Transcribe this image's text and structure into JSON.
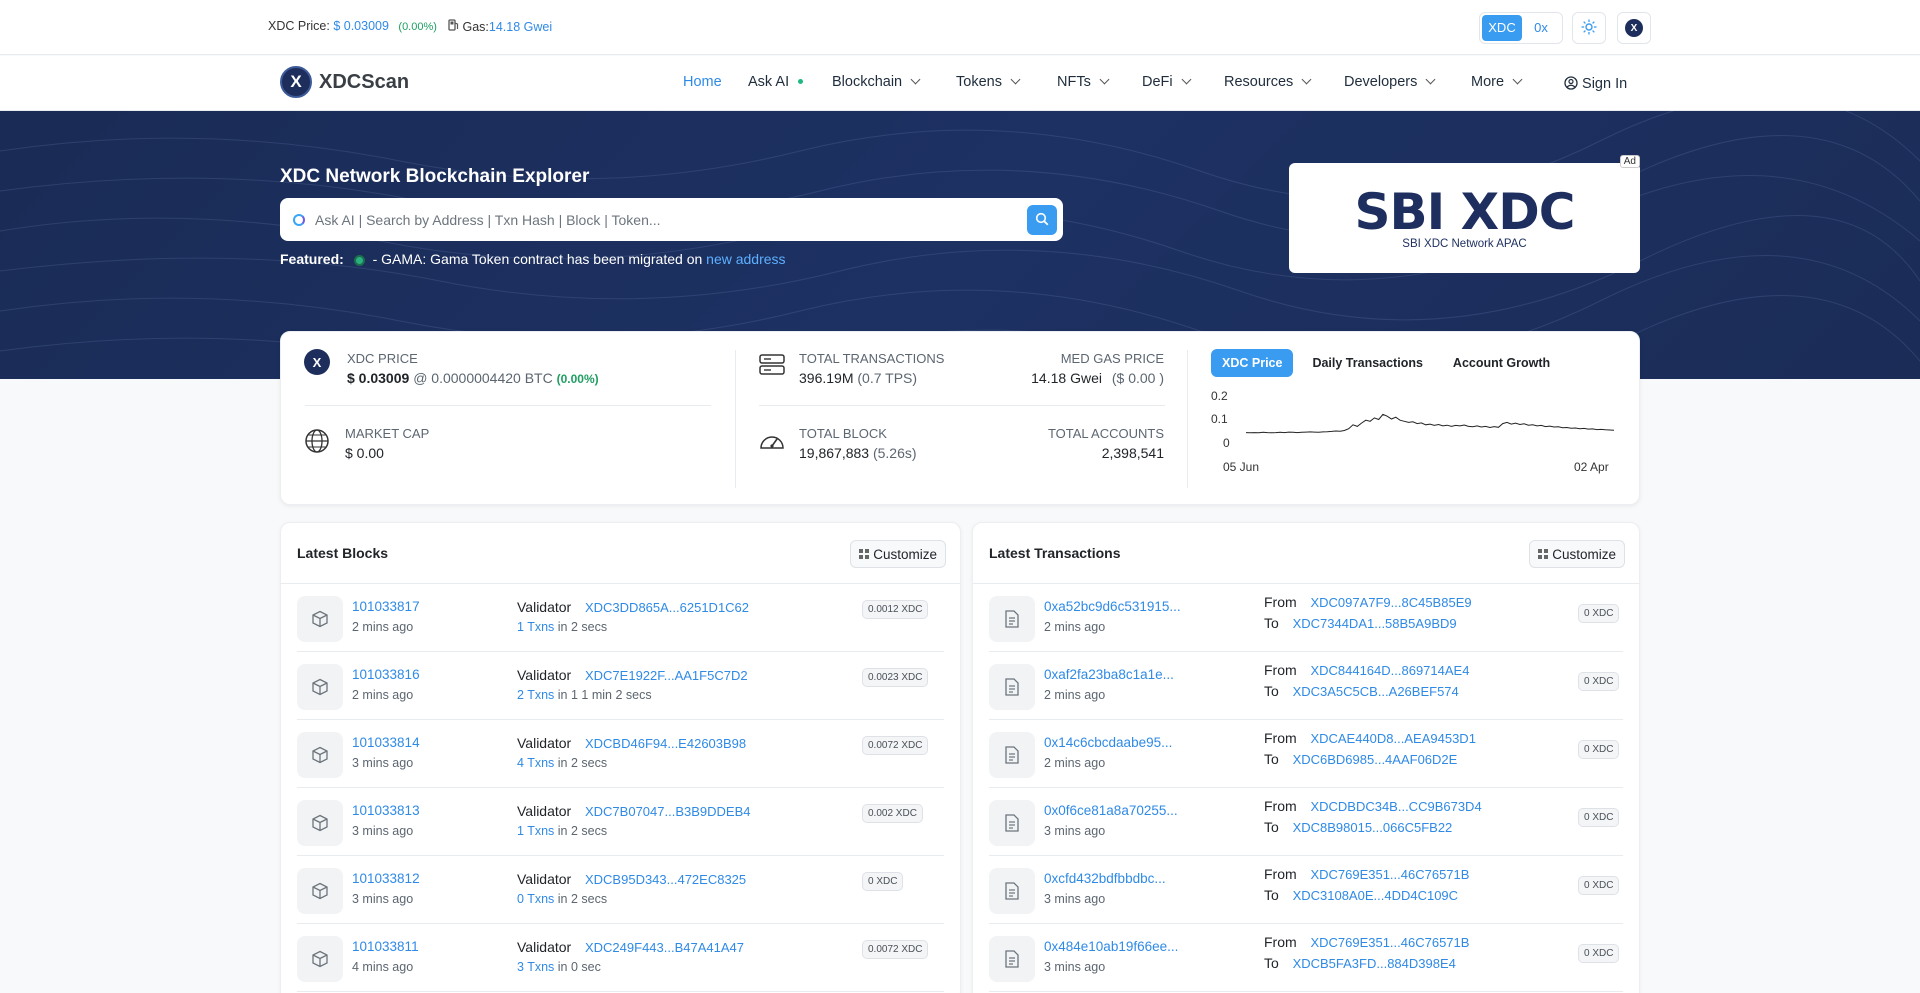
{
  "topbar": {
    "price_label": "XDC Price:",
    "price_value": "$ 0.03009",
    "price_change": "(0.00%)",
    "gas_label": "Gas:",
    "gas_value": "14.18 Gwei",
    "unit_toggle": [
      "XDC",
      "0x"
    ]
  },
  "nav": {
    "brand": "XDCScan",
    "logo_letter": "X",
    "items": [
      "Home",
      "Ask AI",
      "Blockchain",
      "Tokens",
      "NFTs",
      "DeFi",
      "Resources",
      "Developers",
      "More"
    ],
    "sign_in": "Sign In"
  },
  "hero": {
    "title": "XDC Network Blockchain Explorer",
    "search_placeholder": "Ask AI | Search by Address | Txn Hash | Block | Token...",
    "featured_label": "Featured:",
    "featured_text": "- GAMA: Gama Token contract has been migrated on",
    "featured_link": "new address",
    "ad_tag": "Ad",
    "ad_brand": "SBI XDC",
    "ad_sub": "SBI XDC Network APAC"
  },
  "stats": {
    "price_label": "XDC PRICE",
    "price_value": "$ 0.03009",
    "price_btc": "@ 0.0000004420 BTC",
    "price_change": "(0.00%)",
    "mcap_label": "MARKET CAP",
    "mcap_value": "$ 0.00",
    "tx_label": "TOTAL TRANSACTIONS",
    "tx_value": "396.19M",
    "tx_tps": "(0.7 TPS)",
    "gas_label": "MED GAS PRICE",
    "gas_value": "14.18 Gwei",
    "gas_usd": "($ 0.00 )",
    "block_label": "TOTAL BLOCK",
    "block_value": "19,867,883",
    "block_time": "(5.26s)",
    "acct_label": "TOTAL ACCOUNTS",
    "acct_value": "2,398,541",
    "tabs": [
      "XDC Price",
      "Daily Transactions",
      "Account Growth"
    ]
  },
  "chart_data": {
    "type": "line",
    "title": "",
    "xlabel": "",
    "ylabel": "",
    "x_ticks": [
      "05 Jun",
      "02 Apr"
    ],
    "y_ticks": [
      "0.2",
      "0.1",
      "0"
    ],
    "ylim": [
      0,
      0.2
    ],
    "series": [
      {
        "values": [
          0.041,
          0.04,
          0.041,
          0.04,
          0.042,
          0.041,
          0.04,
          0.041,
          0.042,
          0.041,
          0.043,
          0.042,
          0.041,
          0.042,
          0.043,
          0.044,
          0.043,
          0.042,
          0.044,
          0.045,
          0.046,
          0.048,
          0.047,
          0.05,
          0.058,
          0.075,
          0.068,
          0.082,
          0.095,
          0.09,
          0.105,
          0.098,
          0.12,
          0.112,
          0.1,
          0.108,
          0.095,
          0.09,
          0.085,
          0.088,
          0.08,
          0.083,
          0.075,
          0.078,
          0.072,
          0.076,
          0.07,
          0.073,
          0.068,
          0.072,
          0.07,
          0.074,
          0.068,
          0.066,
          0.07,
          0.065,
          0.068,
          0.063,
          0.067,
          0.064,
          0.08,
          0.085,
          0.078,
          0.082,
          0.076,
          0.079,
          0.073,
          0.075,
          0.07,
          0.072,
          0.067,
          0.069,
          0.065,
          0.066,
          0.062,
          0.063,
          0.06,
          0.061,
          0.058,
          0.059,
          0.056,
          0.057,
          0.054,
          0.055,
          0.053,
          0.052,
          0.051
        ]
      }
    ]
  },
  "blocks": {
    "title": "Latest Blocks",
    "customize": "Customize",
    "validator_label": "Validator",
    "rows": [
      {
        "number": "101033817",
        "age": "2 mins ago",
        "validator": "XDC3DD865A...6251D1C62",
        "txns": "1 Txns",
        "time": "in 2 secs",
        "reward": "0.0012 XDC"
      },
      {
        "number": "101033816",
        "age": "2 mins ago",
        "validator": "XDC7E1922F...AA1F5C7D2",
        "txns": "2 Txns",
        "time": "in 1 1 min 2 secs",
        "reward": "0.0023 XDC"
      },
      {
        "number": "101033814",
        "age": "3 mins ago",
        "validator": "XDCBD46F94...E42603B98",
        "txns": "4 Txns",
        "time": "in 2 secs",
        "reward": "0.0072 XDC"
      },
      {
        "number": "101033813",
        "age": "3 mins ago",
        "validator": "XDC7B07047...B3B9DDEB4",
        "txns": "1 Txns",
        "time": "in 2 secs",
        "reward": "0.002 XDC"
      },
      {
        "number": "101033812",
        "age": "3 mins ago",
        "validator": "XDCB95D343...472EC8325",
        "txns": "0 Txns",
        "time": "in 2 secs",
        "reward": "0 XDC"
      },
      {
        "number": "101033811",
        "age": "4 mins ago",
        "validator": "XDC249F443...B47A41A47",
        "txns": "3 Txns",
        "time": "in 0 sec",
        "reward": "0.0072 XDC"
      }
    ]
  },
  "txs": {
    "title": "Latest Transactions",
    "customize": "Customize",
    "from_label": "From",
    "to_label": "To",
    "rows": [
      {
        "hash": "0xa52bc9d6c531915...",
        "age": "2 mins ago",
        "from": "XDC097A7F9...8C45B85E9",
        "to": "XDC7344DA1...58B5A9BD9",
        "value": "0 XDC"
      },
      {
        "hash": "0xaf2fa23ba8c1a1e...",
        "age": "2 mins ago",
        "from": "XDC844164D...869714AE4",
        "to": "XDC3A5C5CB...A26BEF574",
        "value": "0 XDC"
      },
      {
        "hash": "0x14c6cbcdaabe95...",
        "age": "2 mins ago",
        "from": "XDCAE440D8...AEA9453D1",
        "to": "XDC6BD6985...4AAF06D2E",
        "value": "0 XDC"
      },
      {
        "hash": "0x0f6ce81a8a70255...",
        "age": "3 mins ago",
        "from": "XDCDBDC34B...CC9B673D4",
        "to": "XDC8B98015...066C5FB22",
        "value": "0 XDC"
      },
      {
        "hash": "0xcfd432bdfbbdbc...",
        "age": "3 mins ago",
        "from": "XDC769E351...46C76571B",
        "to": "XDC3108A0E...4DD4C109C",
        "value": "0 XDC"
      },
      {
        "hash": "0x484e10ab19f66ee...",
        "age": "3 mins ago",
        "from": "XDC769E351...46C76571B",
        "to": "XDCB5FA3FD...884D398E4",
        "value": "0 XDC"
      }
    ]
  }
}
